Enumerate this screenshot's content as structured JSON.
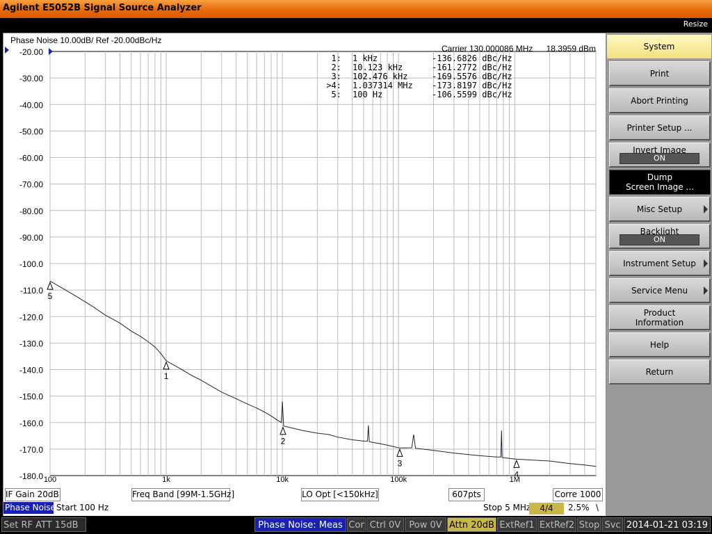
{
  "window": {
    "title": "Agilent E5052B Signal Source Analyzer",
    "resize": "Resize"
  },
  "trace": {
    "title": "Phase Noise 10.00dB/ Ref -20.00dBc/Hz",
    "carrier": "Carrier 130.000086 MHz",
    "carrier_power": "18.3959 dBm"
  },
  "markers": [
    {
      "no": "1:",
      "freq": "1 kHz",
      "value": "-136.6826 dBc/Hz"
    },
    {
      "no": "2:",
      "freq": "10.123 kHz",
      "value": "-161.2772 dBc/Hz"
    },
    {
      "no": "3:",
      "freq": "102.476 kHz",
      "value": "-169.5576 dBc/Hz"
    },
    {
      "no": ">4:",
      "freq": "1.037314 MHz",
      "value": "-173.8197 dBc/Hz"
    },
    {
      "no": "5:",
      "freq": "100 Hz",
      "value": "-106.5599 dBc/Hz"
    }
  ],
  "chart_data": {
    "type": "line",
    "title": "Phase Noise 10.00dB/ Ref -20.00dBc/Hz",
    "x_scale": "log",
    "xlim": [
      100,
      5000000
    ],
    "ylim": [
      -180,
      -20
    ],
    "yticks": [
      "-20.00",
      "-30.00",
      "-40.00",
      "-50.00",
      "-60.00",
      "-70.00",
      "-80.00",
      "-90.00",
      "-100.0",
      "-110.0",
      "-120.0",
      "-130.0",
      "-140.0",
      "-150.0",
      "-160.0",
      "-170.0",
      "-180.0"
    ],
    "xtick_labels": [
      {
        "x": 100,
        "label": "100"
      },
      {
        "x": 1000,
        "label": "1k"
      },
      {
        "x": 10000,
        "label": "10k"
      },
      {
        "x": 100000,
        "label": "100k"
      },
      {
        "x": 1000000,
        "label": "1M"
      }
    ],
    "grid": true,
    "series": [
      {
        "points": [
          [
            100,
            -106.6
          ],
          [
            130,
            -109.5
          ],
          [
            170,
            -112.5
          ],
          [
            220,
            -115.5
          ],
          [
            300,
            -119.5
          ],
          [
            400,
            -122.5
          ],
          [
            500,
            -125.5
          ],
          [
            600,
            -127.5
          ],
          [
            700,
            -129.5
          ],
          [
            800,
            -131.5
          ],
          [
            900,
            -134
          ],
          [
            1000,
            -136.7
          ],
          [
            1300,
            -139.5
          ],
          [
            1700,
            -142.5
          ],
          [
            2000,
            -144
          ],
          [
            2500,
            -146.5
          ],
          [
            3000,
            -148.5
          ],
          [
            4000,
            -151
          ],
          [
            5000,
            -153
          ],
          [
            6000,
            -154.5
          ],
          [
            7000,
            -156
          ],
          [
            8000,
            -157.5
          ],
          [
            9000,
            -159
          ],
          [
            9800,
            -160
          ],
          [
            10000,
            -152
          ],
          [
            10250,
            -161.3
          ],
          [
            12000,
            -162
          ],
          [
            15000,
            -163
          ],
          [
            20000,
            -164
          ],
          [
            25000,
            -164.5
          ],
          [
            30000,
            -165.5
          ],
          [
            40000,
            -166.5
          ],
          [
            50000,
            -167
          ],
          [
            54000,
            -167
          ],
          [
            55000,
            -161
          ],
          [
            56000,
            -167.2
          ],
          [
            60000,
            -167.5
          ],
          [
            70000,
            -168
          ],
          [
            80000,
            -168.5
          ],
          [
            90000,
            -169
          ],
          [
            102476,
            -169.6
          ],
          [
            130000,
            -169.5
          ],
          [
            135000,
            -164.5
          ],
          [
            140000,
            -169.7
          ],
          [
            200000,
            -170.5
          ],
          [
            300000,
            -171.5
          ],
          [
            500000,
            -172.5
          ],
          [
            700000,
            -173
          ],
          [
            760000,
            -173
          ],
          [
            770000,
            -163
          ],
          [
            780000,
            -173.2
          ],
          [
            900000,
            -173.5
          ],
          [
            1037314,
            -173.8
          ],
          [
            1500000,
            -174.2
          ],
          [
            2000000,
            -174.5
          ],
          [
            3000000,
            -175.5
          ],
          [
            4000000,
            -176
          ],
          [
            5000000,
            -176.5
          ]
        ]
      }
    ],
    "marker_points": [
      {
        "label": "1",
        "x": 1000,
        "y": -136.7
      },
      {
        "label": "2",
        "x": 10123,
        "y": -161.3
      },
      {
        "label": "3",
        "x": 102476,
        "y": -169.6
      },
      {
        "label": "4",
        "x": 1037314,
        "y": -173.8
      },
      {
        "label": "5",
        "x": 100,
        "y": -106.6
      }
    ]
  },
  "trace_status": {
    "if_gain": "IF Gain 20dB",
    "freq_band": "Freq Band [99M-1.5GHz]",
    "lo_opt": "LO Opt [<150kHz]",
    "points": "607pts",
    "corre": "Corre 1000"
  },
  "meas_line": {
    "mode": "Phase Noise",
    "start": "Start 100 Hz",
    "stop": "Stop 5 MHz",
    "progress": "4/4",
    "percent": "2.5%",
    "slash": "\\"
  },
  "softkeys": [
    {
      "label": "System",
      "kind": "selected"
    },
    {
      "label": "Print"
    },
    {
      "label": "Abort Printing"
    },
    {
      "label": "Printer Setup ..."
    },
    {
      "label": "Invert Image",
      "value": "ON"
    },
    {
      "label": "Dump",
      "label2": "Screen Image ...",
      "kind": "dark"
    },
    {
      "label": "Misc Setup",
      "arrow": true
    },
    {
      "label": "Backlight",
      "value": "ON"
    },
    {
      "label": "Instrument Setup",
      "arrow": true
    },
    {
      "label": "Service Menu",
      "arrow": true
    },
    {
      "label": "Product",
      "label2": "Information"
    },
    {
      "label": "Help"
    },
    {
      "label": "Return"
    }
  ],
  "statusbar": {
    "message": "Set RF ATT 15dB",
    "meas": "Phase Noise: Meas",
    "cor": "Cor",
    "ctrl": "Ctrl  0V",
    "pow": "Pow  0V",
    "attn": "Attn 20dB",
    "extref1": "ExtRef1",
    "extref2": "ExtRef2",
    "stop": "Stop",
    "svc": "Svc",
    "datetime": "2014-01-21 03:19"
  }
}
